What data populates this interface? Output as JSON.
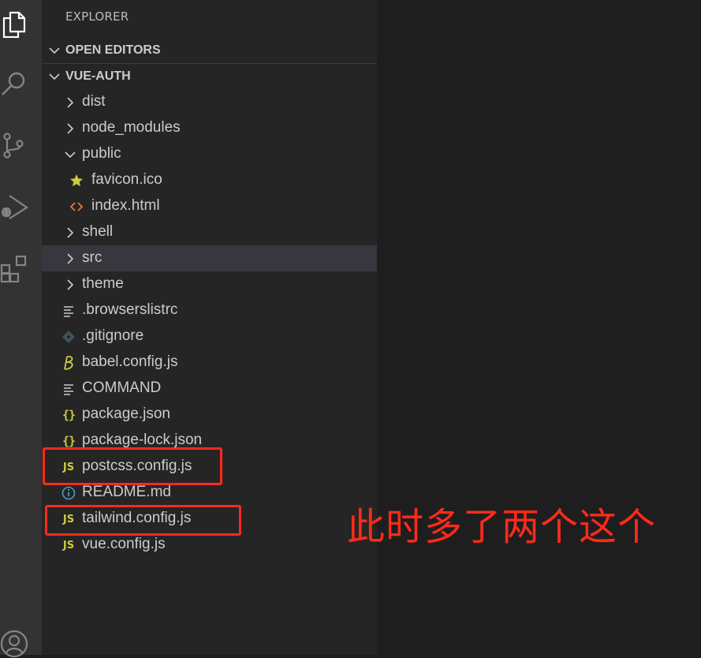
{
  "activity_bar": {
    "icons": [
      "files-icon",
      "search-icon",
      "source-control-icon",
      "run-debug-icon",
      "extensions-icon",
      "account-icon"
    ]
  },
  "sidebar": {
    "title": "EXPLORER",
    "open_editors_label": "OPEN EDITORS",
    "project_label": "VUE-AUTH",
    "items": [
      {
        "name": "dist",
        "type": "folder",
        "expanded": false
      },
      {
        "name": "node_modules",
        "type": "folder",
        "expanded": false
      },
      {
        "name": "public",
        "type": "folder",
        "expanded": true
      },
      {
        "name": "favicon.ico",
        "type": "file",
        "icon": "star-icon"
      },
      {
        "name": "index.html",
        "type": "file",
        "icon": "html-icon"
      },
      {
        "name": "shell",
        "type": "folder",
        "expanded": false
      },
      {
        "name": "src",
        "type": "folder",
        "expanded": false,
        "selected": true
      },
      {
        "name": "theme",
        "type": "folder",
        "expanded": false
      },
      {
        "name": ".browserslistrc",
        "type": "file",
        "icon": "lines-icon"
      },
      {
        "name": ".gitignore",
        "type": "file",
        "icon": "git-icon"
      },
      {
        "name": "babel.config.js",
        "type": "file",
        "icon": "babel-icon"
      },
      {
        "name": "COMMAND",
        "type": "file",
        "icon": "lines-icon"
      },
      {
        "name": "package.json",
        "type": "file",
        "icon": "json-icon"
      },
      {
        "name": "package-lock.json",
        "type": "file",
        "icon": "json-icon"
      },
      {
        "name": "postcss.config.js",
        "type": "file",
        "icon": "js-icon"
      },
      {
        "name": "README.md",
        "type": "file",
        "icon": "info-icon"
      },
      {
        "name": "tailwind.config.js",
        "type": "file",
        "icon": "js-icon"
      },
      {
        "name": "vue.config.js",
        "type": "file",
        "icon": "js-icon"
      }
    ],
    "js_badge": "JS",
    "json_badge": "{}"
  },
  "annotation": {
    "text": "此时多了两个这个",
    "color": "#ff2a1a"
  },
  "colors": {
    "activity_bar": "#333333",
    "sidebar": "#252526",
    "editor": "#1e1e1e",
    "selected_row": "#37373d",
    "text": "#cccccc",
    "js_yellow": "#cbcb41",
    "html_orange": "#e37933",
    "info_blue": "#519aba",
    "highlight_red": "#ff2a1a"
  }
}
